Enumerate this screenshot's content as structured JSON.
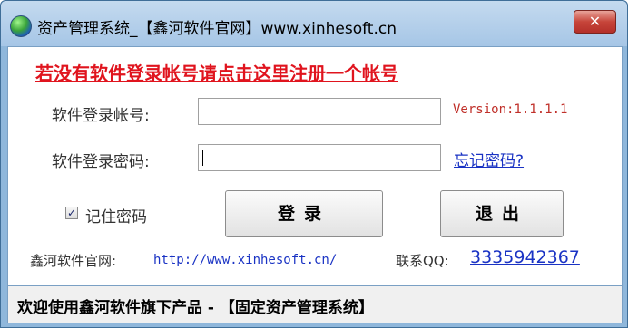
{
  "window": {
    "title": "资产管理系统_【鑫河软件官网】www.xinhesoft.cn",
    "close_glyph": "✕"
  },
  "register": {
    "link_text": "若没有软件登录帐号请点击这里注册一个帐号"
  },
  "form": {
    "account_label": "软件登录帐号:",
    "account_value": "",
    "password_label": "软件登录密码:",
    "password_value": "",
    "version": "Version:1.1.1.1",
    "forgot_link": "忘记密码?",
    "remember_label": "记住密码",
    "remember_checked": true,
    "check_glyph": "✓",
    "login_button": "登录",
    "exit_button": "退出"
  },
  "footer": {
    "site_label": "鑫河软件官网:",
    "site_url": "http://www.xinhesoft.cn/",
    "qq_label": "联系QQ:",
    "qq_number": "3335942367"
  },
  "status": {
    "text": "欢迎使用鑫河软件旗下产品 - 【固定资产管理系统】"
  },
  "colors": {
    "register_link": "#e0141e",
    "link": "#1a33c4",
    "version": "#c0302a",
    "titlebar": "#a6c6e6"
  },
  "icons": {
    "app": "globe-icon",
    "close": "close-icon",
    "check": "check-icon"
  }
}
